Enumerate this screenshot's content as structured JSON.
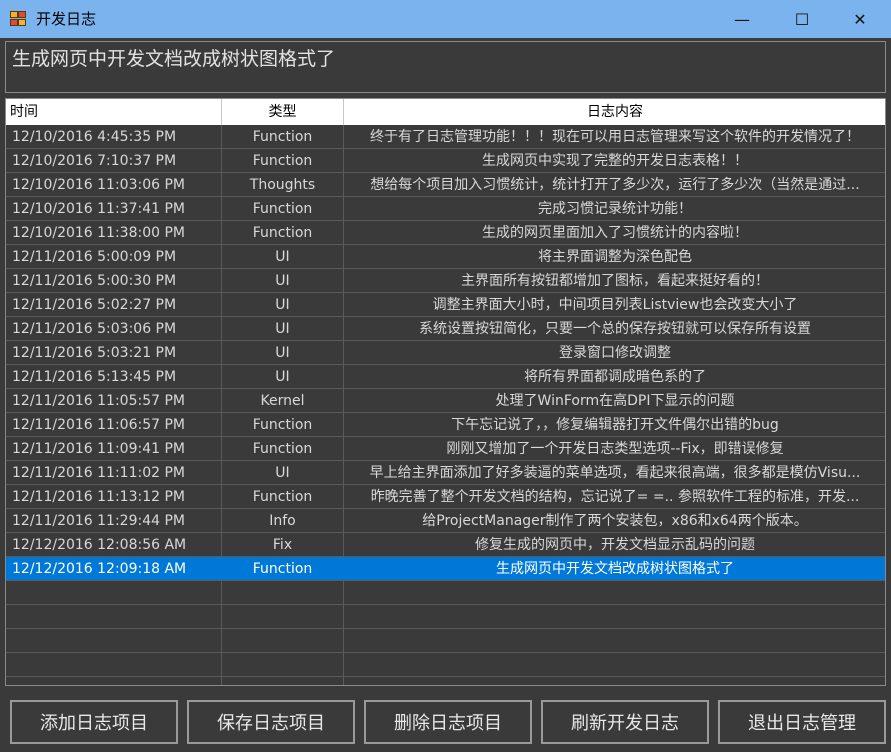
{
  "window": {
    "title": "开发日志",
    "minimize_glyph": "—",
    "maximize_glyph": "☐",
    "close_glyph": "✕",
    "icon": "app-icon"
  },
  "current_entry": "生成网页中开发文档改成树状图格式了",
  "table": {
    "columns": [
      "时间",
      "类型",
      "日志内容"
    ],
    "rows": [
      {
        "time": "12/10/2016 4:45:35 PM",
        "type": "Function",
        "content": "终于有了日志管理功能！！！现在可以用日志管理来写这个软件的开发情况了！"
      },
      {
        "time": "12/10/2016 7:10:37 PM",
        "type": "Function",
        "content": "生成网页中实现了完整的开发日志表格！！"
      },
      {
        "time": "12/10/2016 11:03:06 PM",
        "type": "Thoughts",
        "content": "想给每个项目加入习惯统计，统计打开了多少次，运行了多少次（当然是通过..."
      },
      {
        "time": "12/10/2016 11:37:41 PM",
        "type": "Function",
        "content": "完成习惯记录统计功能！"
      },
      {
        "time": "12/10/2016 11:38:00 PM",
        "type": "Function",
        "content": "生成的网页里面加入了习惯统计的内容啦！"
      },
      {
        "time": "12/11/2016 5:00:09 PM",
        "type": "UI",
        "content": "将主界面调整为深色配色"
      },
      {
        "time": "12/11/2016 5:00:30 PM",
        "type": "UI",
        "content": "主界面所有按钮都增加了图标，看起来挺好看的！"
      },
      {
        "time": "12/11/2016 5:02:27 PM",
        "type": "UI",
        "content": "调整主界面大小时，中间项目列表Listview也会改变大小了"
      },
      {
        "time": "12/11/2016 5:03:06 PM",
        "type": "UI",
        "content": "系统设置按钮简化，只要一个总的保存按钮就可以保存所有设置"
      },
      {
        "time": "12/11/2016 5:03:21 PM",
        "type": "UI",
        "content": "登录窗口修改调整"
      },
      {
        "time": "12/11/2016 5:13:45 PM",
        "type": "UI",
        "content": "将所有界面都调成暗色系的了"
      },
      {
        "time": "12/11/2016 11:05:57 PM",
        "type": "Kernel",
        "content": "处理了WinForm在高DPI下显示的问题"
      },
      {
        "time": "12/11/2016 11:06:57 PM",
        "type": "Function",
        "content": "下午忘记说了，，修复编辑器打开文件偶尔出错的bug"
      },
      {
        "time": "12/11/2016 11:09:41 PM",
        "type": "Function",
        "content": "刚刚又增加了一个开发日志类型选项--Fix，即错误修复"
      },
      {
        "time": "12/11/2016 11:11:02 PM",
        "type": "UI",
        "content": "早上给主界面添加了好多装逼的菜单选项，看起来很高端，很多都是模仿Visu..."
      },
      {
        "time": "12/11/2016 11:13:12 PM",
        "type": "Function",
        "content": "昨晚完善了整个开发文档的结构，忘记说了= =.. 参照软件工程的标准，开发..."
      },
      {
        "time": "12/11/2016 11:29:44 PM",
        "type": "Info",
        "content": "给ProjectManager制作了两个安装包，x86和x64两个版本。"
      },
      {
        "time": "12/12/2016 12:08:56 AM",
        "type": "Fix",
        "content": "修复生成的网页中，开发文档显示乱码的问题"
      },
      {
        "time": "12/12/2016 12:09:18 AM",
        "type": "Function",
        "content": "生成网页中开发文档改成树状图格式了"
      }
    ],
    "selected_index": 18,
    "empty_rows": 5
  },
  "buttons": {
    "add": "添加日志项目",
    "save": "保存日志项目",
    "delete": "删除日志项目",
    "refresh": "刷新开发日志",
    "exit": "退出日志管理"
  },
  "colors": {
    "titlebar": "#7ab3ee",
    "background": "#3a3a3a",
    "selection": "#0078d7",
    "text": "#d8d8d8"
  }
}
